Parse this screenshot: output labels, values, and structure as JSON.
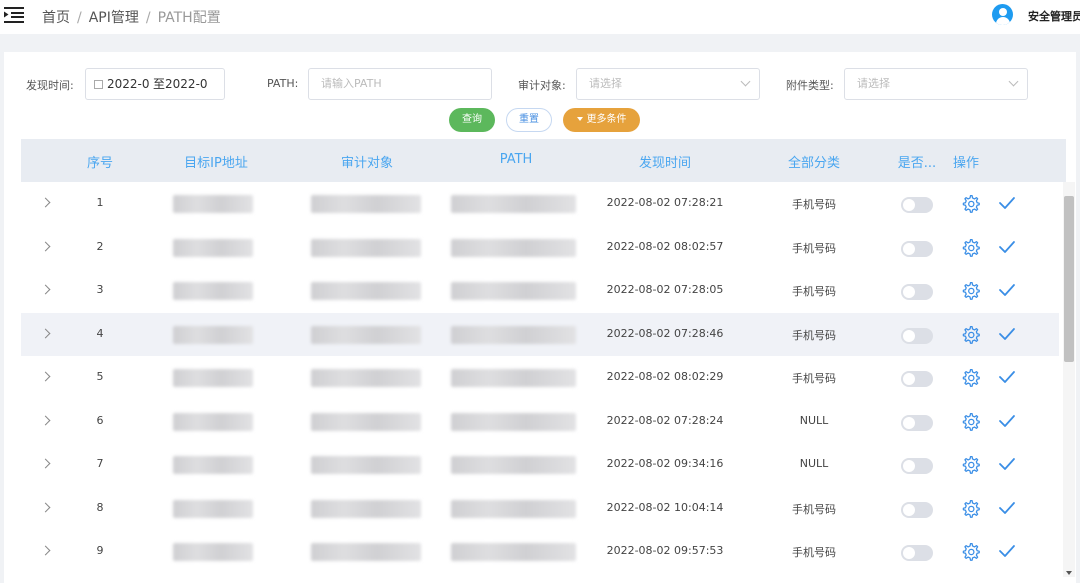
{
  "breadcrumb": {
    "home": "首页",
    "sep1": "/",
    "api": "API管理",
    "sep2": "/",
    "current": "PATH配置"
  },
  "user": {
    "name": "安全管理员"
  },
  "filters": {
    "discover_time_label": "发现时间:",
    "date_start": "2022-0",
    "date_sep": "至",
    "date_end": "2022-0",
    "path_label": "PATH:",
    "path_placeholder": "请输入PATH",
    "audit_target_label": "审计对象:",
    "audit_target_placeholder": "请选择",
    "attachment_type_label": "附件类型:",
    "attachment_type_placeholder": "请选择"
  },
  "buttons": {
    "query": "查询",
    "reset": "重置",
    "more": "更多条件"
  },
  "table": {
    "headers": {
      "index": "序号",
      "target_ip": "目标IP地址",
      "audit_target": "审计对象",
      "path": "PATH",
      "discover_time": "发现时间",
      "category": "全部分类",
      "is_enabled": "是否...",
      "actions": "操作"
    },
    "rows": [
      {
        "index": "1",
        "time": "2022-08-02 07:28:21",
        "category": "手机号码"
      },
      {
        "index": "2",
        "time": "2022-08-02 08:02:57",
        "category": "手机号码"
      },
      {
        "index": "3",
        "time": "2022-08-02 07:28:05",
        "category": "手机号码"
      },
      {
        "index": "4",
        "time": "2022-08-02 07:28:46",
        "category": "手机号码"
      },
      {
        "index": "5",
        "time": "2022-08-02 08:02:29",
        "category": "手机号码"
      },
      {
        "index": "6",
        "time": "2022-08-02 07:28:24",
        "category": "NULL"
      },
      {
        "index": "7",
        "time": "2022-08-02 09:34:16",
        "category": "NULL"
      },
      {
        "index": "8",
        "time": "2022-08-02 10:04:14",
        "category": "手机号码"
      },
      {
        "index": "9",
        "time": "2022-08-02 09:57:53",
        "category": "手机号码"
      }
    ]
  },
  "colors": {
    "accent": "#1e9bf0",
    "header_text": "#4aa6f0",
    "query_btn": "#5cb85c",
    "more_btn": "#e6a23c",
    "icon_blue": "#3a8ee6"
  },
  "icons": {
    "menu": "menu-fold-icon",
    "user": "user-icon",
    "expand": "chevron-right-icon",
    "settings": "gear-icon",
    "confirm": "check-icon",
    "calendar": "calendar-icon",
    "dropdown": "chevron-down-icon"
  }
}
